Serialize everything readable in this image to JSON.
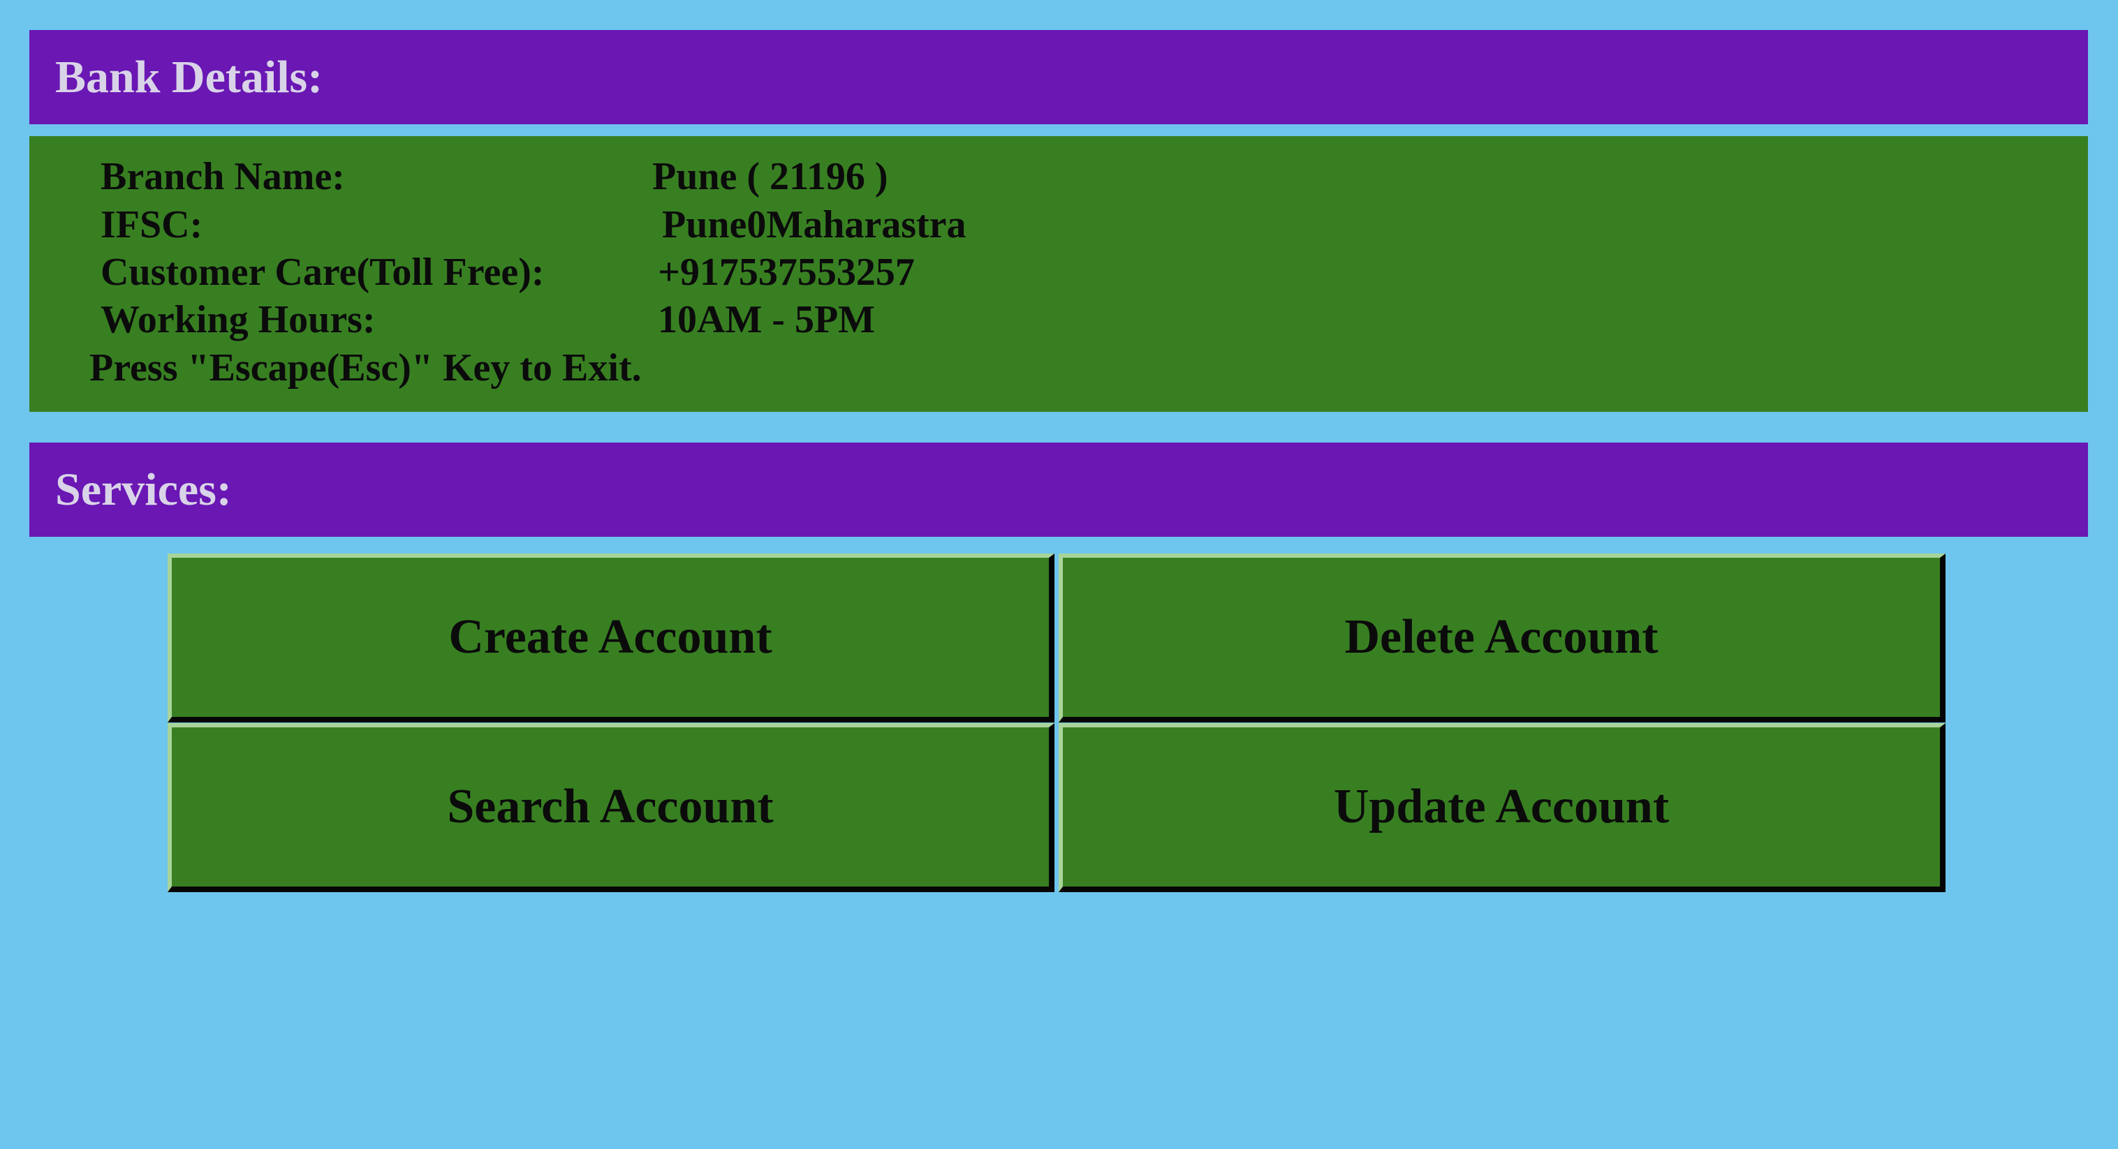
{
  "bank": {
    "header": "Bank Details:",
    "details": [
      {
        "label": "Branch Name:",
        "value": "Pune ( 21196 )"
      },
      {
        "label": "IFSC:",
        "value": "Pune0Maharastra"
      },
      {
        "label": "Customer Care(Toll Free):",
        "value": "+917537553257"
      },
      {
        "label": "Working Hours:",
        "value": "10AM - 5PM"
      }
    ],
    "exit_note": "Press \"Escape(Esc)\" Key to Exit."
  },
  "services": {
    "header": "Services:",
    "buttons": {
      "create": "Create Account",
      "delete": "Delete Account",
      "search": "Search Account",
      "update": "Update Account"
    }
  },
  "colors": {
    "background": "#6ec5ed",
    "header": "#6a17b4",
    "panel": "#387f22"
  }
}
